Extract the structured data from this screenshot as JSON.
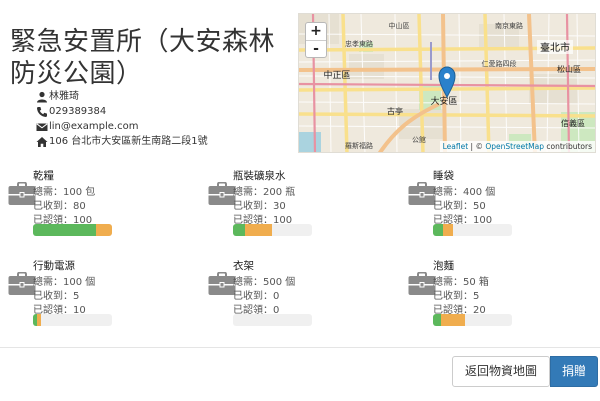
{
  "page": {
    "title": "緊急安置所（大安森林防災公園）"
  },
  "contact": {
    "name": "林雅琦",
    "phone": "029389384",
    "email": "lin@example.com",
    "address": "106 台北市大安區新生南路二段1號"
  },
  "map": {
    "zoom_in": "+",
    "zoom_out": "-",
    "attrib_leaflet": "Leaflet",
    "attrib_sep": " | © ",
    "attrib_osm": "OpenStreetMap",
    "attrib_tail": " contributors",
    "labels": [
      "臺北市",
      "中正區",
      "大安區",
      "信義區",
      "中山區",
      "松山區",
      "古亭",
      "公館",
      "南京東路",
      "仁愛路四段",
      "忠孝東路",
      "羅斯福路"
    ]
  },
  "items": [
    {
      "name": "乾糧",
      "need": "總需：100 包",
      "received": "已收到：80",
      "claimed": "已認領：100",
      "received_pct": 80,
      "claimed_pct": 100
    },
    {
      "name": "瓶裝礦泉水",
      "need": "總需：200 瓶",
      "received": "已收到：30",
      "claimed": "已認領：100",
      "received_pct": 15,
      "claimed_pct": 50
    },
    {
      "name": "睡袋",
      "need": "總需：400 個",
      "received": "已收到：50",
      "claimed": "已認領：100",
      "received_pct": 12.5,
      "claimed_pct": 25
    },
    {
      "name": "行動電源",
      "need": "總需：100 個",
      "received": "已收到：5",
      "claimed": "已認領：10",
      "received_pct": 5,
      "claimed_pct": 10
    },
    {
      "name": "衣架",
      "need": "總需：500 個",
      "received": "已收到：0",
      "claimed": "已認領：0",
      "received_pct": 0,
      "claimed_pct": 0
    },
    {
      "name": "泡麵",
      "need": "總需：50 箱",
      "received": "已收到：5",
      "claimed": "已認領：20",
      "received_pct": 10,
      "claimed_pct": 40
    }
  ],
  "buttons": {
    "back": "返回物資地圖",
    "donate": "捐贈"
  },
  "colors": {
    "received": "#5cb85c",
    "claimed": "#f0ad4e",
    "primary": "#337ab7",
    "marker": "#2a81cb"
  }
}
